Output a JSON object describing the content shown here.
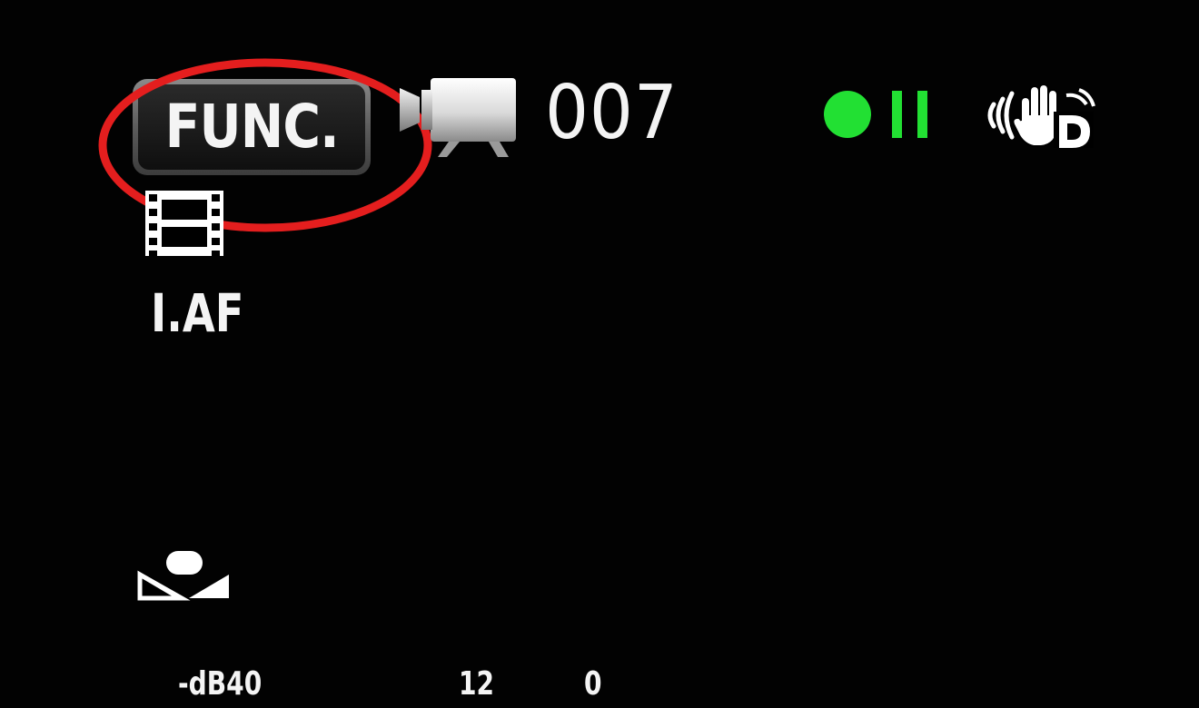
{
  "func_button": {
    "label": "FUNC."
  },
  "status_bar": {
    "counter": "007",
    "mode_icon": "movie-camera-icon",
    "record_state_icon": "record-pause-icon",
    "stabilizer_icon": "image-stabilizer-dynamic-icon"
  },
  "left_panel": {
    "movie_mode_icon": "film-strip-icon",
    "af_mode": "I.AF"
  },
  "bottom": {
    "level_icon": "level-indicator-icon",
    "audio_scale": {
      "db_label": "-dB40",
      "mid": "12",
      "zero": "0"
    }
  },
  "colors": {
    "annotation_ellipse": "#e41e1e",
    "record_indicator": "#22e033",
    "text": "#f4f4f4",
    "background": "#020202"
  }
}
